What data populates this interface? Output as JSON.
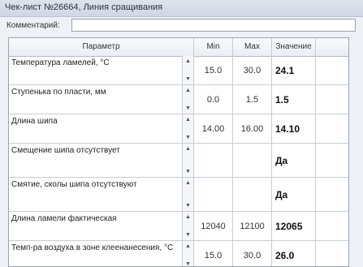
{
  "window": {
    "title": "Чек-лист №26664, Линия сращивания"
  },
  "comment": {
    "label": "Комментарий:",
    "value": ""
  },
  "table": {
    "headers": {
      "param": "Параметр",
      "min": "Min",
      "max": "Max",
      "value": "Значение"
    },
    "rows": [
      {
        "param": "Температура ламелей, °С",
        "min": "15.0",
        "max": "30.0",
        "value": "24.1"
      },
      {
        "param": "Ступенька по пласти, мм",
        "min": "0.0",
        "max": "1.5",
        "value": "1.5"
      },
      {
        "param": "Длина шипа",
        "min": "14.00",
        "max": "16.00",
        "value": "14.10"
      },
      {
        "param": "Смещение шипа отсутствует",
        "min": "",
        "max": "",
        "value": "Да"
      },
      {
        "param": "Смятие, сколы шипа отсутствуют",
        "min": "",
        "max": "",
        "value": "Да"
      },
      {
        "param": "Длина ламели фактическая",
        "min": "12040",
        "max": "12100",
        "value": "12065"
      },
      {
        "param": "Темп-ра воздуха в зоне клеенанесения, °С",
        "min": "15.0",
        "max": "30.0",
        "value": "26.0"
      }
    ]
  },
  "icons": {
    "spin_up": "▲",
    "spin_down": "▼"
  }
}
